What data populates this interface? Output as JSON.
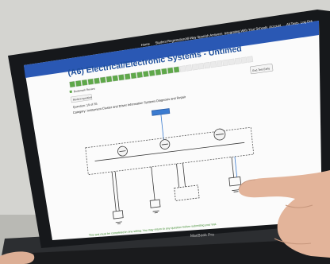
{
  "nav": {
    "links": [
      "Home",
      "Student Registration",
      "All-Way Spanish Answers",
      "Integrating With Your Schools",
      "Account",
      "All Tests",
      "Log Out"
    ]
  },
  "page": {
    "title": "(A6) Electrical/Electronic Systems - Untimed"
  },
  "controls": {
    "flag_text": "Bookmark Review",
    "review_button": "Review question",
    "end_button": "End Test Early"
  },
  "question": {
    "counter": "Question: 19 of 35",
    "category": "Category: Instrument Cluster and Driver Information Systems Diagnosis and Repair"
  },
  "progress": {
    "total_segments": 30,
    "completed_segments": 18
  },
  "footer": {
    "notice": "This test must be completed in one sitting. You may return to any question before submitting your test."
  },
  "device": {
    "brand": "MacBook Pro"
  },
  "colors": {
    "navbar": "#2a58b4",
    "title": "#1e4f9c",
    "progress_done": "#5fa84a",
    "progress_todo": "#eaeaea",
    "bezel": "#16181b",
    "wiring": "#3a3a3a",
    "wire_blue": "#3b7bd0"
  }
}
